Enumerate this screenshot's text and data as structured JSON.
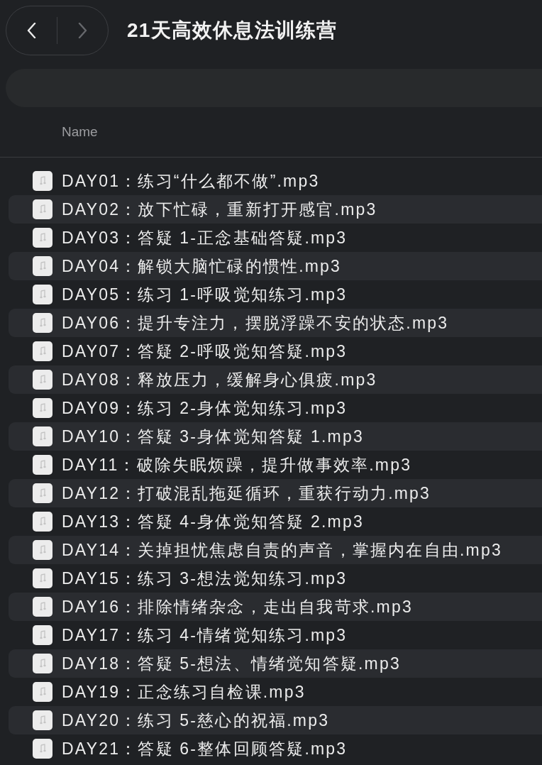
{
  "window": {
    "title": "21天高效休息法训练营"
  },
  "toolbar": {
    "nav_buttons": [
      {
        "kind": "back",
        "disabled": false
      },
      {
        "kind": "forward",
        "disabled": true
      }
    ]
  },
  "table": {
    "columns": [
      "Name"
    ],
    "rows": [
      {
        "name": "DAY01：练习“什么都不做”.mp3"
      },
      {
        "name": "DAY02：放下忙碌，重新打开感官.mp3"
      },
      {
        "name": "DAY03：答疑 1-正念基础答疑.mp3"
      },
      {
        "name": "DAY04：解锁大脑忙碌的惯性.mp3"
      },
      {
        "name": "DAY05：练习 1-呼吸觉知练习.mp3"
      },
      {
        "name": "DAY06：提升专注力，摆脱浮躁不安的状态.mp3"
      },
      {
        "name": "DAY07：答疑 2-呼吸觉知答疑.mp3"
      },
      {
        "name": "DAY08：释放压力，缓解身心俱疲.mp3"
      },
      {
        "name": "DAY09：练习 2-身体觉知练习.mp3"
      },
      {
        "name": "DAY10：答疑 3-身体觉知答疑 1.mp3"
      },
      {
        "name": "DAY11：破除失眠烦躁，提升做事效率.mp3"
      },
      {
        "name": "DAY12：打破混乱拖延循环，重获行动力.mp3"
      },
      {
        "name": "DAY13：答疑 4-身体觉知答疑 2.mp3"
      },
      {
        "name": "DAY14：关掉担忧焦虑自责的声音，掌握内在自由.mp3"
      },
      {
        "name": "DAY15：练习 3-想法觉知练习.mp3"
      },
      {
        "name": "DAY16：排除情绪杂念，走出自我苛求.mp3"
      },
      {
        "name": "DAY17：练习 4-情绪觉知练习.mp3"
      },
      {
        "name": "DAY18：答疑 5-想法、情绪觉知答疑.mp3"
      },
      {
        "name": "DAY19：正念练习自检课.mp3"
      },
      {
        "name": "DAY20：练习 5-慈心的祝福.mp3"
      },
      {
        "name": "DAY21：答疑 6-整体回顾答疑.mp3"
      }
    ]
  }
}
